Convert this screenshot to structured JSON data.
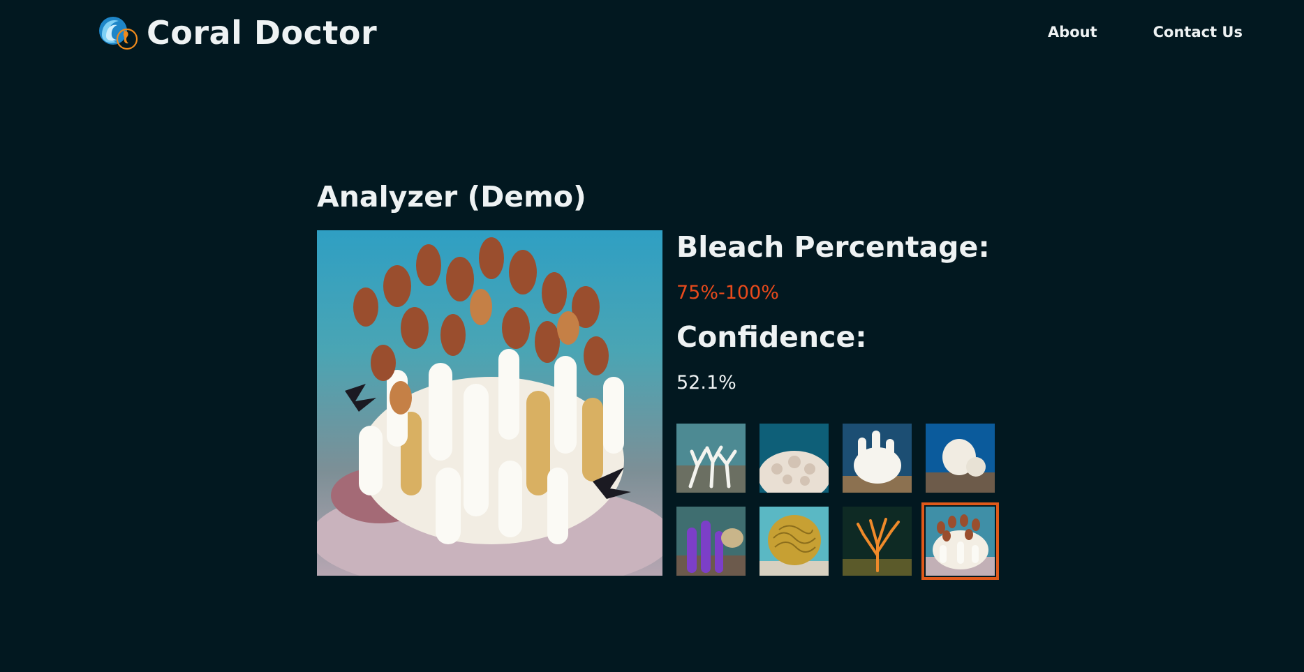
{
  "brand": {
    "name": "Coral Doctor",
    "logo_icon": "wave-seahorse-logo-icon"
  },
  "nav": {
    "about": "About",
    "contact": "Contact Us"
  },
  "analyzer": {
    "title": "Analyzer (Demo)",
    "bleach_label": "Bleach Percentage:",
    "bleach_value": "75%-100%",
    "confidence_label": "Confidence:",
    "confidence_value": "52.1%"
  },
  "colors": {
    "background": "#021820",
    "bleach_value": "#e84a1c",
    "selected_outline": "#e0591a"
  },
  "samples": [
    {
      "id": "bleached-branching",
      "selected": false
    },
    {
      "id": "bleached-boulder",
      "selected": false
    },
    {
      "id": "bleached-white-cluster",
      "selected": false
    },
    {
      "id": "bleached-mound",
      "selected": false
    },
    {
      "id": "purple-soft-coral",
      "selected": false
    },
    {
      "id": "brain-coral",
      "selected": false
    },
    {
      "id": "orange-sea-fan",
      "selected": false
    },
    {
      "id": "partially-bleached-finger-coral",
      "selected": true
    }
  ]
}
